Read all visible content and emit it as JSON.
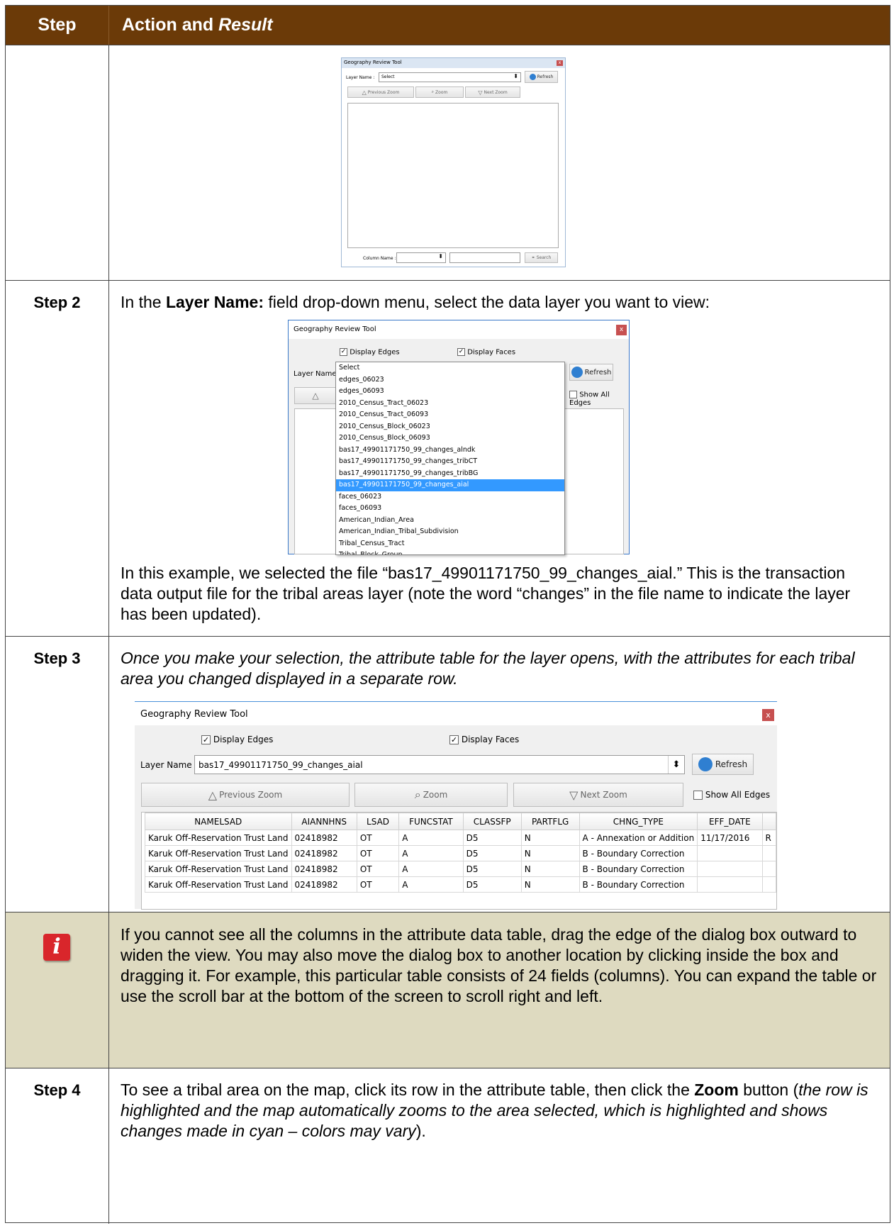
{
  "header": {
    "step": "Step",
    "action_plain": "Action and ",
    "action_italic": "Result"
  },
  "row1": {
    "dialog": {
      "title": "Geography Review Tool",
      "layer_label": "Layer Name :",
      "layer_value": "Select",
      "refresh": "Refresh",
      "prev_zoom": "Previous Zoom",
      "zoom": "Zoom",
      "next_zoom": "Next Zoom",
      "column_label": "Column Name :",
      "search": "Search"
    }
  },
  "step2": {
    "label": "Step 2",
    "text_before": "In the ",
    "text_bold": "Layer Name:",
    "text_after": " field drop-down menu, select the data layer you want to view:",
    "dialog": {
      "title": "Geography Review Tool",
      "close": "x",
      "display_edges": "Display Edges",
      "display_faces": "Display Faces",
      "layer_label": "Layer Name :",
      "refresh": "Refresh",
      "show_all_edges": "Show All Edges",
      "options": [
        "Select",
        "edges_06023",
        "edges_06093",
        "2010_Census_Tract_06023",
        "2010_Census_Tract_06093",
        "2010_Census_Block_06023",
        "2010_Census_Block_06093",
        "bas17_49901171750_99_changes_alndk",
        "bas17_49901171750_99_changes_tribCT",
        "bas17_49901171750_99_changes_tribBG",
        "bas17_49901171750_99_changes_aial",
        "faces_06023",
        "faces_06093",
        "American_Indian_Area",
        "American_Indian_Tribal_Subdivision",
        "Tribal_Census_Tract",
        "Tribal_Block_Group"
      ],
      "selected_option": "bas17_49901171750_99_changes_aial"
    },
    "paragraph": "In this example, we selected the file “bas17_49901171750_99_changes_aial.” This is the transaction data output file for the tribal areas layer (note the word “changes” in the file name to indicate the layer has been updated)."
  },
  "step3": {
    "label": "Step 3",
    "text": "Once you make your selection, the attribute table for the layer opens, with the attributes for each tribal area you changed displayed in a separate row.",
    "dialog": {
      "title": "Geography Review Tool",
      "close": "x",
      "display_edges": "Display Edges",
      "display_faces": "Display Faces",
      "layer_label": "Layer Name :",
      "layer_value": "bas17_49901171750_99_changes_aial",
      "refresh": "Refresh",
      "prev_zoom": "Previous Zoom",
      "zoom": "Zoom",
      "next_zoom": "Next Zoom",
      "show_all_edges": "Show All Edges",
      "columns": [
        "NAMELSAD",
        "AIANNHNS",
        "LSAD",
        "FUNCSTAT",
        "CLASSFP",
        "PARTFLG",
        "CHNG_TYPE",
        "EFF_DATE",
        ""
      ],
      "rows": [
        [
          "Karuk Off-Reservation Trust Land",
          "02418982",
          "OT",
          "A",
          "D5",
          "N",
          "A - Annexation or Addition",
          "11/17/2016",
          "R"
        ],
        [
          "Karuk Off-Reservation Trust Land",
          "02418982",
          "OT",
          "A",
          "D5",
          "N",
          "B - Boundary Correction",
          "",
          ""
        ],
        [
          "Karuk Off-Reservation Trust Land",
          "02418982",
          "OT",
          "A",
          "D5",
          "N",
          "B - Boundary Correction",
          "",
          ""
        ],
        [
          "Karuk Off-Reservation Trust Land",
          "02418982",
          "OT",
          "A",
          "D5",
          "N",
          "B - Boundary Correction",
          "",
          ""
        ]
      ]
    }
  },
  "note": {
    "icon": "info-icon",
    "icon_glyph": "i",
    "text": "If you cannot see all the columns in the attribute data table, drag the edge of the dialog box outward to widen the view. You may also move the dialog box to another location by clicking inside the box and dragging it. For example, this particular table consists of 24 fields (columns). You can expand the table or use the scroll bar at the bottom of the screen to scroll right and left."
  },
  "step4": {
    "label": "Step 4",
    "text_a": "To see a tribal area on the map, click its row in the attribute table, then click the ",
    "text_bold": "Zoom",
    "text_b": " button (",
    "text_italic": "the row is highlighted and the map automatically zooms to the area selected, which is highlighted and shows changes made in cyan – colors may vary",
    "text_c": ")."
  },
  "colors": {
    "header_bg": "#6b3a08",
    "note_bg": "#dedac0",
    "selection": "#3399ff",
    "close_btn": "#c75050",
    "info_icon": "#d9262b"
  }
}
